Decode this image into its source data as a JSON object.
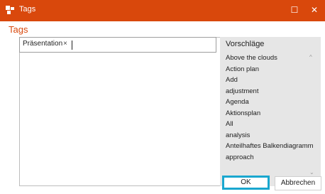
{
  "window": {
    "title": "Tags",
    "maximize_glyph": "☐",
    "close_glyph": "✕",
    "titlebar_color": "#d9480c"
  },
  "heading": "Tags",
  "tag_input": {
    "chips": [
      {
        "label": "Präsentation",
        "remove_glyph": "×"
      }
    ],
    "value": ""
  },
  "suggestions": {
    "title": "Vorschläge",
    "items": [
      "Above the clouds",
      "Action plan",
      "Add",
      "adjustment",
      "Agenda",
      "Aktionsplan",
      "All",
      "analysis",
      "Anteilhaftes Balkendiagramm",
      "approach"
    ],
    "scroll_up_glyph": "^",
    "scroll_down_glyph": "⌄"
  },
  "buttons": {
    "ok": "OK",
    "cancel": "Abbrechen"
  }
}
